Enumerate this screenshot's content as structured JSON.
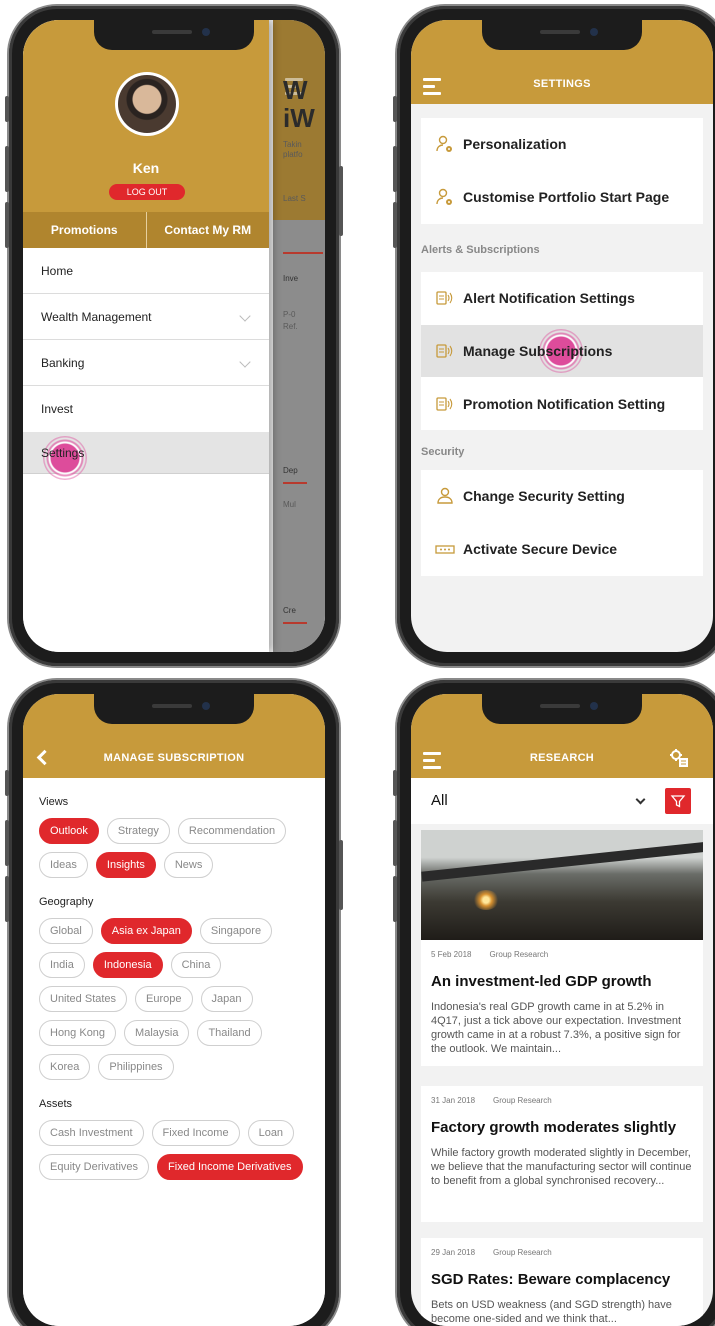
{
  "phone1": {
    "user_name": "Ken",
    "logout_label": "LOG OUT",
    "promotions_label": "Promotions",
    "contact_rm_label": "Contact My RM",
    "menu": [
      {
        "label": "Home"
      },
      {
        "label": "Wealth Management"
      },
      {
        "label": "Banking"
      },
      {
        "label": "Invest"
      },
      {
        "label": "Settings"
      }
    ],
    "background": {
      "big_text_1": "W",
      "big_text_2": "iW",
      "small_1": "Takin",
      "small_2": "platfo",
      "last_s": "Last S",
      "inve": "Inve",
      "p0": "P-0",
      "ref": "Ref.",
      "dep": "Dep",
      "mul": "Mul",
      "cre": "Cre"
    }
  },
  "phone2": {
    "title": "SETTINGS",
    "items_top": [
      {
        "label": "Personalization",
        "icon": "user-gear-icon"
      },
      {
        "label": "Customise Portfolio Start Page",
        "icon": "user-gear-icon"
      }
    ],
    "section_alerts": "Alerts & Subscriptions",
    "items_alerts": [
      {
        "label": "Alert Notification Settings",
        "icon": "notification-icon"
      },
      {
        "label": "Manage Subscriptions",
        "icon": "notification-icon"
      },
      {
        "label": "Promotion Notification Setting",
        "icon": "notification-icon"
      }
    ],
    "section_security": "Security",
    "items_security": [
      {
        "label": "Change Security Setting",
        "icon": "user-lock-icon"
      },
      {
        "label": "Activate Secure Device",
        "icon": "secure-device-icon"
      }
    ]
  },
  "phone3": {
    "title": "MANAGE SUBSCRIPTION",
    "views_label": "Views",
    "views": [
      {
        "label": "Outlook",
        "on": true
      },
      {
        "label": "Strategy",
        "on": false
      },
      {
        "label": "Recommendation",
        "on": false
      },
      {
        "label": "Ideas",
        "on": false
      },
      {
        "label": "Insights",
        "on": true
      },
      {
        "label": "News",
        "on": false
      }
    ],
    "geography_label": "Geography",
    "geography": [
      {
        "label": "Global",
        "on": false
      },
      {
        "label": "Asia ex Japan",
        "on": true
      },
      {
        "label": "Singapore",
        "on": false
      },
      {
        "label": "India",
        "on": false
      },
      {
        "label": "Indonesia",
        "on": true
      },
      {
        "label": "China",
        "on": false
      },
      {
        "label": "United States",
        "on": false
      },
      {
        "label": "Europe",
        "on": false
      },
      {
        "label": "Japan",
        "on": false
      },
      {
        "label": "Hong Kong",
        "on": false
      },
      {
        "label": "Malaysia",
        "on": false
      },
      {
        "label": "Thailand",
        "on": false
      },
      {
        "label": "Korea",
        "on": false
      },
      {
        "label": "Philippines",
        "on": false
      }
    ],
    "assets_label": "Assets",
    "assets": [
      {
        "label": "Cash Investment",
        "on": false
      },
      {
        "label": "Fixed Income",
        "on": false
      },
      {
        "label": "Loan",
        "on": false
      },
      {
        "label": "Equity Derivatives",
        "on": false
      },
      {
        "label": "Fixed Income Derivatives",
        "on": true
      }
    ]
  },
  "phone4": {
    "title": "RESEARCH",
    "filter_value": "All",
    "articles": [
      {
        "date": "5 Feb 2018",
        "source": "Group Research",
        "title": "An investment-led GDP growth",
        "body": "Indonesia's real GDP growth came in at 5.2% in 4Q17, just a tick above our expectation. Investment growth came in at a robust 7.3%, a positive sign for the outlook. We maintain..."
      },
      {
        "date": "31 Jan 2018",
        "source": "Group Research",
        "title": "Factory growth moderates slightly",
        "body": "While factory growth moderated slightly in December, we believe that the manufacturing sector will continue to benefit from a global synchronised recovery..."
      },
      {
        "date": "29 Jan 2018",
        "source": "Group Research",
        "title": "SGD Rates: Beware complacency",
        "body": "Bets on USD weakness (and SGD strength) have become one-sided and we think that..."
      }
    ]
  },
  "colors": {
    "gold": "#c79a3b",
    "red": "#e0282c",
    "tap": "#dd4c9b"
  }
}
